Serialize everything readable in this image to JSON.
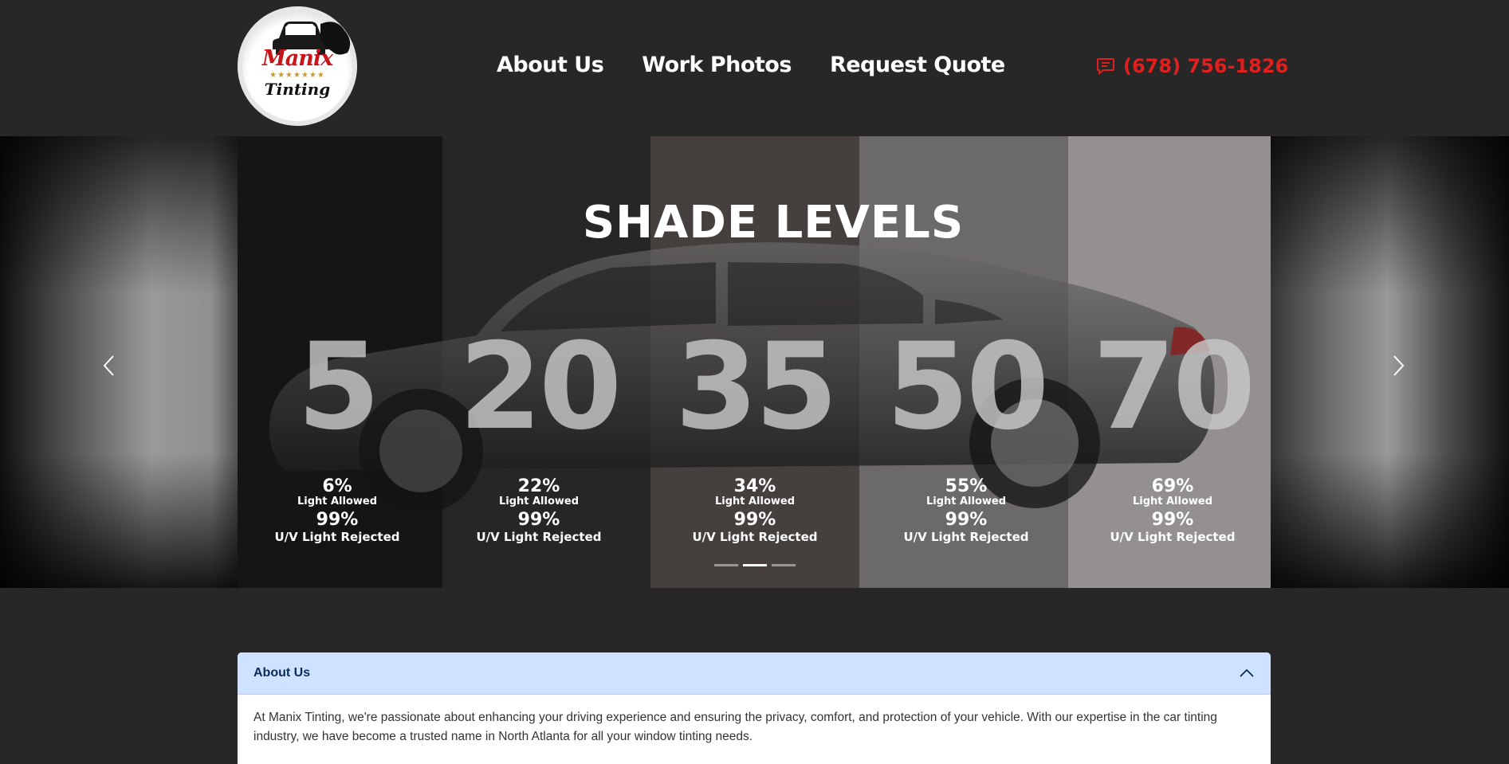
{
  "header": {
    "logo": {
      "line1": "Manix",
      "line2": "Tinting",
      "stars": "★★★★★★★"
    },
    "nav": [
      {
        "label": "About Us"
      },
      {
        "label": "Work Photos"
      },
      {
        "label": "Request Quote"
      }
    ],
    "phone": {
      "icon": "message-icon",
      "number": "(678) 756-1826"
    }
  },
  "carousel": {
    "title": "SHADE LEVELS",
    "shades": [
      {
        "level": "5",
        "light_pct": "6%",
        "light_label": "Light Allowed",
        "uv_pct": "99%",
        "uv_label": "U/V Light Rejected"
      },
      {
        "level": "20",
        "light_pct": "22%",
        "light_label": "Light Allowed",
        "uv_pct": "99%",
        "uv_label": "U/V Light Rejected"
      },
      {
        "level": "35",
        "light_pct": "34%",
        "light_label": "Light Allowed",
        "uv_pct": "99%",
        "uv_label": "U/V Light Rejected"
      },
      {
        "level": "50",
        "light_pct": "55%",
        "light_label": "Light Allowed",
        "uv_pct": "99%",
        "uv_label": "U/V Light Rejected"
      },
      {
        "level": "70",
        "light_pct": "69%",
        "light_label": "Light Allowed",
        "uv_pct": "99%",
        "uv_label": "U/V Light Rejected"
      }
    ],
    "slide_count": 3,
    "active_slide": 2,
    "prev_icon": "chevron-left-icon",
    "next_icon": "chevron-right-icon"
  },
  "about": {
    "title": "About Us",
    "toggle_icon": "chevron-up-icon",
    "body": "At Manix Tinting, we're passionate about enhancing your driving experience and ensuring the privacy, comfort, and protection of your vehicle. With our expertise in the car tinting industry, we have become a trusted name in North Atlanta for all your window tinting needs."
  },
  "colors": {
    "background": "#272727",
    "accent_red": "#e01f1f",
    "accordion_header": "#cfe2ff"
  }
}
